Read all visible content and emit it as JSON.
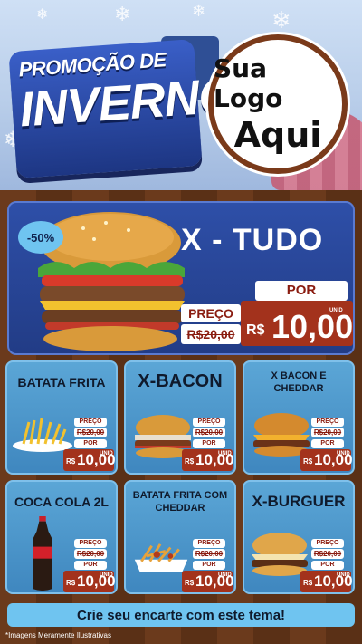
{
  "header": {
    "title_line1": "PROMOÇÃO DE",
    "title_line2": "INVERNO",
    "logo_line1": "Sua Logo",
    "logo_line2": "Aqui"
  },
  "hero": {
    "discount": "-50%",
    "name": "X - TUDO",
    "preco_label": "PREÇO",
    "old_price": "R$20,00",
    "por_label": "POR",
    "currency": "R$",
    "new_price": "10,00",
    "unit": "UNID"
  },
  "items": [
    {
      "name": "BATATA FRITA",
      "preco_label": "PREÇO",
      "old_price": "R$20,00",
      "por_label": "POR",
      "currency": "R$",
      "new_price": "10,00",
      "unit": "UNID"
    },
    {
      "name": "X-BACON",
      "preco_label": "PREÇO",
      "old_price": "R$20,00",
      "por_label": "POR",
      "currency": "R$",
      "new_price": "10,00",
      "unit": "UNID"
    },
    {
      "name": "X BACON E CHEDDAR",
      "preco_label": "PREÇO",
      "old_price": "R$20,00",
      "por_label": "POR",
      "currency": "R$",
      "new_price": "10,00",
      "unit": "UNID"
    },
    {
      "name": "COCA COLA 2L",
      "preco_label": "PREÇO",
      "old_price": "R$20,00",
      "por_label": "POR",
      "currency": "R$",
      "new_price": "10,00",
      "unit": "UNID"
    },
    {
      "name": "BATATA FRITA COM CHEDDAR",
      "preco_label": "PREÇO",
      "old_price": "R$20,00",
      "por_label": "POR",
      "currency": "R$",
      "new_price": "10,00",
      "unit": "UNID"
    },
    {
      "name": "X-BURGUER",
      "preco_label": "PREÇO",
      "old_price": "R$20,00",
      "por_label": "POR",
      "currency": "R$",
      "new_price": "10,00",
      "unit": "UNID"
    }
  ],
  "footer": {
    "cta": "Crie seu encarte com este tema!",
    "disclaimer": "*Imagens Meramente Ilustrativas"
  },
  "colors": {
    "header_bg": "#b8cde9",
    "title_blue": "#2e4fa8",
    "wood": "#6b3a1c",
    "card_blue": "#4a96cc",
    "price_red": "#a3321c",
    "cta_bg": "#6fc4f0"
  },
  "icons": [
    "snowflake-icon",
    "heart-icon",
    "burger-image",
    "fries-image",
    "soda-bottle-image"
  ]
}
